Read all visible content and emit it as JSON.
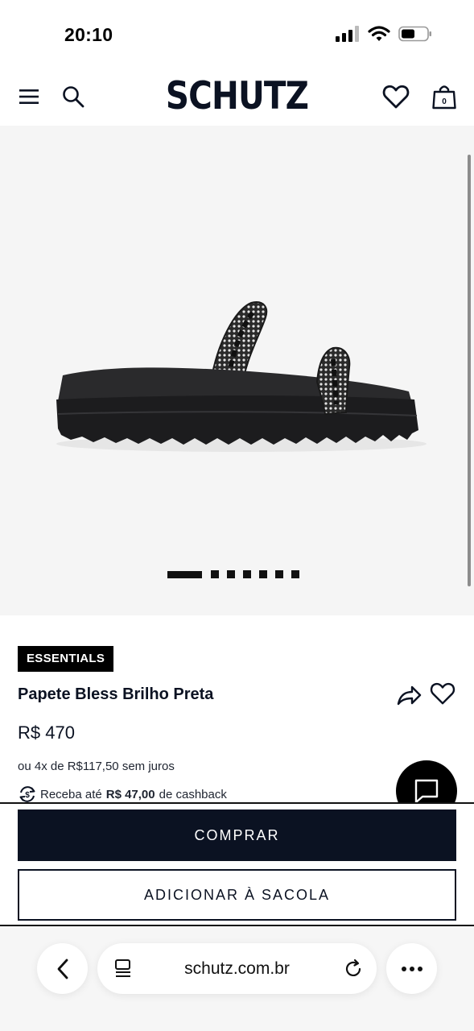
{
  "status_bar": {
    "time": "20:10"
  },
  "header": {
    "logo": "SCHUTZ",
    "bag_count": "0"
  },
  "gallery": {
    "image_count": 7,
    "active_index": 0
  },
  "product": {
    "badge": "ESSENTIALS",
    "title": "Papete Bless Brilho Preta",
    "price": "R$ 470",
    "installments": "ou 4x de R$117,50 sem juros",
    "cashback_prefix": "Receba até",
    "cashback_amount": "R$ 47,00",
    "cashback_suffix": "de cashback"
  },
  "actions": {
    "buy": "COMPRAR",
    "add_to_bag": "ADICIONAR À SACOLA"
  },
  "browser": {
    "url": "schutz.com.br"
  },
  "colors": {
    "brand_navy": "#0b1222",
    "gallery_bg": "#f5f5f5",
    "badge_bg": "#000000"
  }
}
